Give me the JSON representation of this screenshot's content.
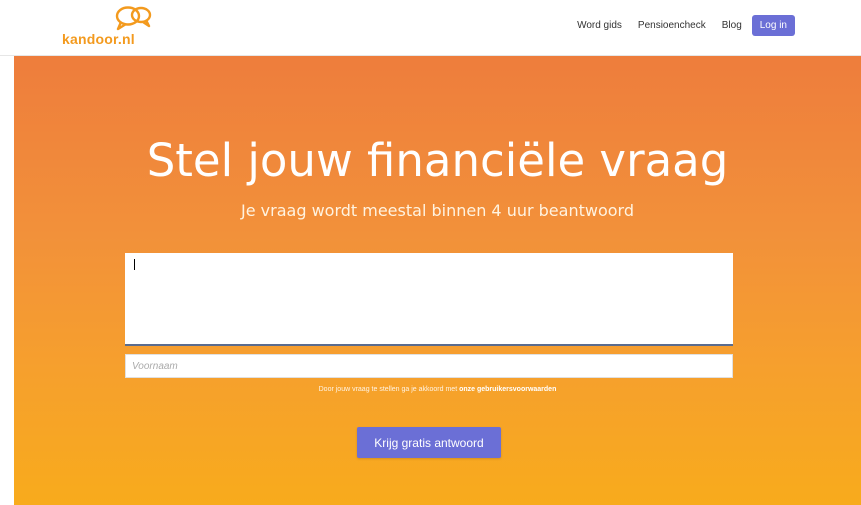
{
  "brand": {
    "name": "kandoor.nl",
    "color": "#f39a1e"
  },
  "nav": {
    "items": [
      "Word gids",
      "Pensioencheck",
      "Blog"
    ],
    "login_label": "Log in",
    "accent": "#6b6fd6"
  },
  "hero": {
    "title": "Stel jouw financiële vraag",
    "subtitle": "Je vraag wordt meestal binnen 4 uur beantwoord",
    "question_value": "",
    "name_placeholder": "Voornaam",
    "terms_prefix": "Door jouw vraag te stellen ga je akkoord met ",
    "terms_link": "onze gebruikersvoorwaarden",
    "cta_label": "Krijg gratis antwoord",
    "gradient_top": "#ee7d3c",
    "gradient_bottom": "#f8ab1c"
  }
}
